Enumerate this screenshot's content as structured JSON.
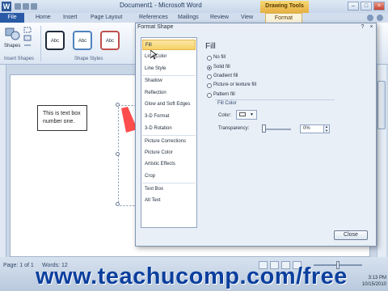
{
  "window": {
    "title": "Document1 - Microsoft Word",
    "app_icon_letter": "W",
    "minimize": "–",
    "maximize": "□",
    "close": "×"
  },
  "contextual_tab_group": "Drawing Tools",
  "ribbon_tabs": {
    "file": "File",
    "home": "Home",
    "insert": "Insert",
    "page_layout": "Page Layout",
    "references": "References",
    "mailings": "Mailings",
    "review": "Review",
    "view": "View",
    "format": "Format"
  },
  "ribbon": {
    "shapes_label": "Shapes",
    "insert_shapes_group": "Insert Shapes",
    "shape_styles_group": "Shape Styles",
    "style_buttons": [
      "Abc",
      "Abc",
      "Abc"
    ]
  },
  "document": {
    "text_box": "This is text box number one."
  },
  "dialog": {
    "title": "Format Shape",
    "help": "?",
    "close_x": "×",
    "categories": [
      "Fill",
      "Line Color",
      "Line Style",
      "Shadow",
      "Reflection",
      "Glow and Soft Edges",
      "3-D Format",
      "3-D Rotation",
      "Picture Corrections",
      "Picture Color",
      "Artistic Effects",
      "Crop",
      "Text Box",
      "Alt Text"
    ],
    "panel_title": "Fill",
    "fill_options": [
      {
        "label": "No fill",
        "checked": false
      },
      {
        "label": "Solid fill",
        "checked": true
      },
      {
        "label": "Gradient fill",
        "checked": false
      },
      {
        "label": "Picture or texture fill",
        "checked": false
      },
      {
        "label": "Pattern fill",
        "checked": false
      }
    ],
    "fill_color_section": "Fill Color",
    "color_label": "Color:",
    "transparency_label": "Transparency:",
    "transparency_value": "0%",
    "close_button": "Close"
  },
  "status_bar": {
    "page": "Page: 1 of 1",
    "words": "Words: 12"
  },
  "watermark": "www.teachucomp.com/free",
  "clock": {
    "time": "3:13 PM",
    "date": "10/15/2010"
  },
  "colors": {
    "accent": "#2a5aa6",
    "selection": "#f6d267",
    "shape_fill": "#ff3a3a"
  }
}
